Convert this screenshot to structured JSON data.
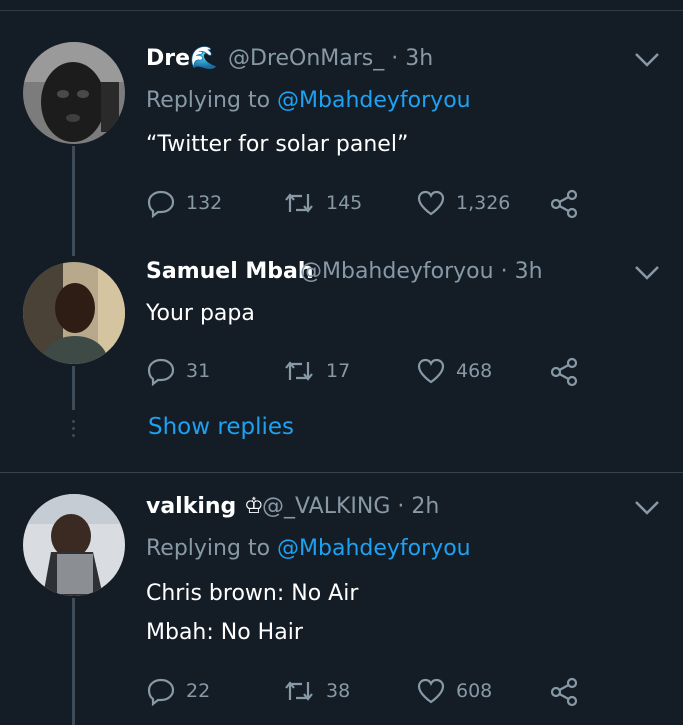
{
  "tweets": [
    {
      "name": "Dre",
      "name_emoji": "🌊",
      "handle": "@DreOnMars_",
      "time": "3h",
      "replying_prefix": "Replying to",
      "replying_to": "@Mbahdeyforyou",
      "lines": [
        "“Twitter for solar panel”"
      ],
      "replies": "132",
      "retweets": "145",
      "likes": "1,326"
    },
    {
      "name": "Samuel Mbah",
      "handle": "@Mbahdeyforyou",
      "time": "3h",
      "lines": [
        "Your papa"
      ],
      "replies": "31",
      "retweets": "17",
      "likes": "468"
    },
    {
      "name": "valking",
      "name_emoji": "♔",
      "handle": "@_VALKING",
      "time": "2h",
      "replying_prefix": "Replying to",
      "replying_to": "@Mbahdeyforyou",
      "lines": [
        "Chris brown: No Air",
        "Mbah: No Hair"
      ],
      "replies": "22",
      "retweets": "38",
      "likes": "608"
    }
  ],
  "show_replies": "Show replies",
  "separator": "·",
  "icons": [
    "reply-icon",
    "retweet-icon",
    "like-icon",
    "share-icon",
    "chevron-down-icon"
  ],
  "colors": {
    "background": "#141d26",
    "muted": "#8899a6",
    "link": "#1da1f2",
    "divider": "#38444d"
  }
}
